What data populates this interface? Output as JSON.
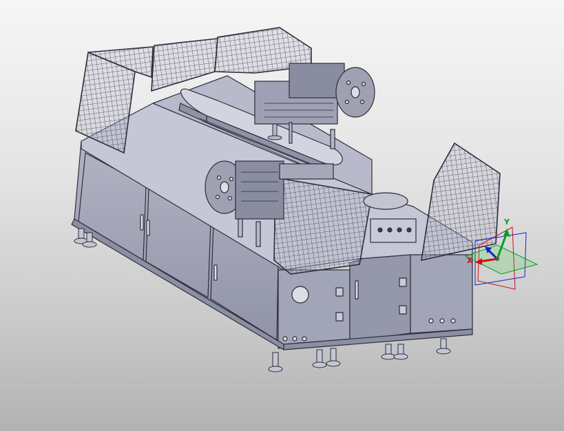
{
  "viewport": {
    "background_top": "#f6f6f6",
    "background_bottom": "#b2b2b2"
  },
  "model": {
    "edge_color": "#2a2d3a",
    "panel_fill": "#a4a6b8",
    "panel_dark": "#8c8ea2",
    "table_top_fill": "#c5c7d6",
    "mesh_color": "#3a3d4c",
    "mesh_fill": "#b9bbcc",
    "disk_fill": "#9fa1b3",
    "tower_light_colors": [
      "#d52020",
      "#e0c020",
      "#30b030"
    ]
  },
  "triad": {
    "x_label": "X",
    "y_label": "Y",
    "x_color": "#d01010",
    "y_color": "#00a020",
    "z_color": "#1020d0"
  }
}
